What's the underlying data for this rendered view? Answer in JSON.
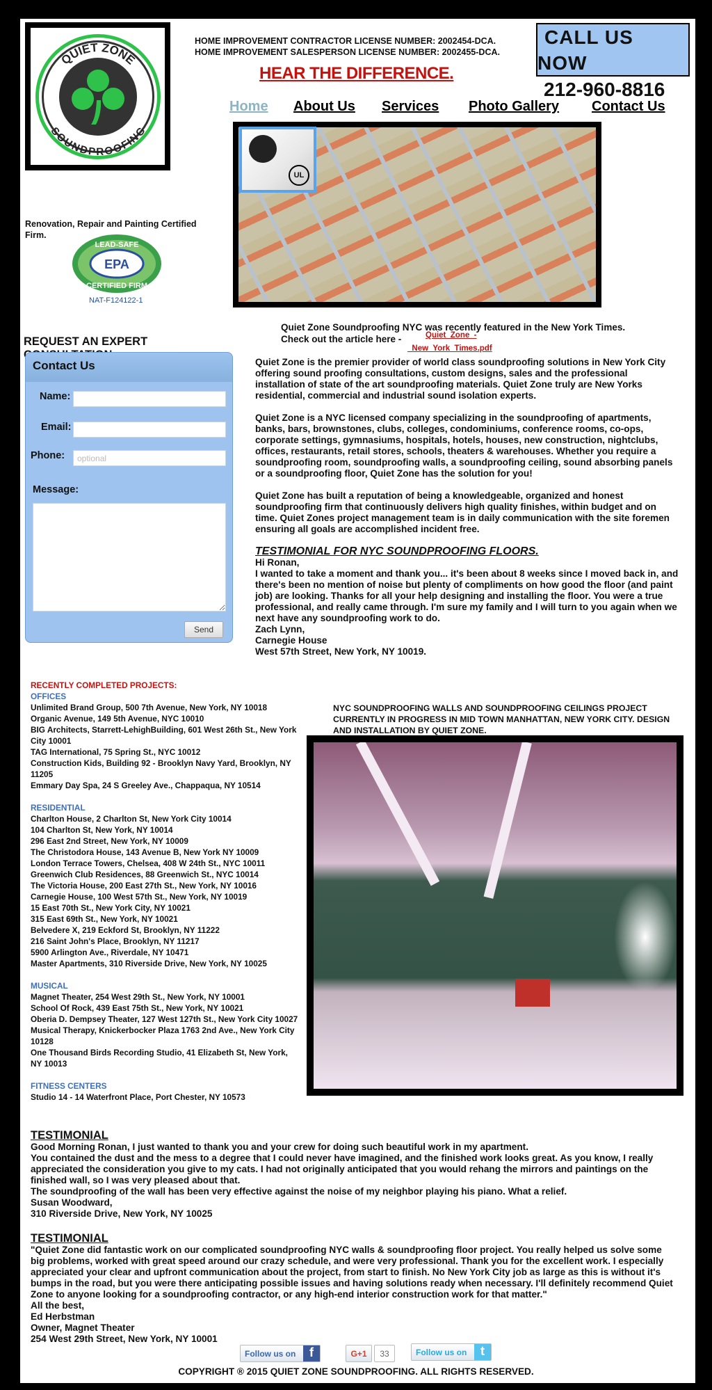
{
  "logo": {
    "top_text": "QUIET ZONE",
    "bottom_text": "SOUNDPROOFING"
  },
  "header": {
    "license_1": "HOME IMPROVEMENT CONTRACTOR LICENSE NUMBER: 2002454-DCA.",
    "license_2": "HOME IMPROVEMENT SALESPERSON LICENSE NUMBER: 2002455-DCA.",
    "tagline": "HEAR THE DIFFERENCE.",
    "call_line1": "CALL US",
    "call_line2": "NOW",
    "phone": "212-960-8816"
  },
  "nav": {
    "items": [
      {
        "label": "Home",
        "active": true
      },
      {
        "label": "About Us"
      },
      {
        "label": "Services"
      },
      {
        "label": "Photo Gallery"
      },
      {
        "label": "Contact Us"
      }
    ]
  },
  "certification": {
    "text": "Renovation, Repair and Painting Certified Firm.",
    "badge_top": "LEAD-SAFE",
    "badge_mid": "EPA",
    "badge_bottom": "CERTIFIED FIRM",
    "number": "NAT-F124122-1",
    "ul_mark": "UL"
  },
  "nyt": {
    "text": "Quiet Zone Soundproofing NYC was recently featured in the New York Times. Check out the article here -",
    "link_part1": "Quiet_Zone_-",
    "link_part2": "_New_York_Times.pdf"
  },
  "form": {
    "request_title": "REQUEST AN EXPERT CONSULTATION",
    "title": "Contact Us",
    "name_label": "Name:",
    "name_value": "",
    "email_label": "Email:",
    "email_value": "",
    "phone_label": "Phone:",
    "phone_placeholder": "optional",
    "message_label": "Message:",
    "message_value": "",
    "send_label": "Send"
  },
  "main": {
    "p1": "Quiet Zone is the premier provider of world class soundproofing solutions in New York City offering sound proofing consultations, custom designs, sales and the professional installation of state of the art soundproofing materials. Quiet Zone truly are New Yorks residential, commercial and industrial sound isolation experts.",
    "p2": "Quiet Zone is a NYC licensed company specializing in the soundproofing of apartments, banks, bars, brownstones, clubs, colleges, condominiums, conference rooms, co-ops, corporate settings, gymnasiums, hospitals, hotels, houses, new construction, nightclubs, offices, restaurants, retail stores, schools, theaters & warehouses. Whether you require a soundproofing room, soundproofing walls, a soundproofing ceiling, sound absorbing panels or a soundproofing floor, Quiet Zone has the solution for you!",
    "p3": "Quiet Zone has built a reputation of being a knowledgeable, organized and honest soundproofing firm that continuously delivers high quality finishes, within budget and on time. Quiet Zones project management team is in daily communication with the site foremen ensuring all goals are accomplished incident free.",
    "testimonial_heading": "TESTIMONIAL FOR NYC SOUNDPROOFING FLOORS.",
    "testimonial_lines": [
      "Hi Ronan,",
      "I wanted to take a moment and thank you... it's been about 8 weeks since I moved back in, and there's been no mention of noise but plenty of compliments on how good the floor (and paint job) are looking. Thanks for all your help designing and installing the floor. You were a true professional, and really came through. I'm sure my family and I will turn to you again when we next have any soundproofing work to do.",
      "Zach Lynn,",
      "Carnegie House",
      "West 57th Street, New York, NY 10019."
    ]
  },
  "projects": {
    "title": "RECENTLY COMPLETED PROJECTS:",
    "categories": [
      {
        "name": "OFFICES",
        "items": [
          "Unlimited Brand Group, 500 7th Avenue, New York, NY 10018",
          "Organic Avenue, 149 5th Avenue, NYC 10010",
          "BIG Architects, Starrett-LehighBuilding, 601 West 26th St., New York City 10001",
          "TAG International, 75 Spring St., NYC 10012",
          "Construction Kids, Building 92 - Brooklyn Navy Yard, Brooklyn, NY 11205",
          "Emmary Day Spa, 24 S Greeley Ave., Chappaqua, NY 10514"
        ]
      },
      {
        "name": "RESIDENTIAL",
        "items": [
          "Charlton House, 2 Charlton St, New York City 10014",
          "104 Charlton St, New York, NY 10014",
          "296 East 2nd Street, New York, NY 10009",
          "The Christodora House, 143 Avenue B, New York NY 10009",
          "London Terrace Towers, Chelsea, 408 W 24th St., NYC 10011",
          "Greenwich Club Residences, 88 Greenwich St., NYC 10014",
          "The Victoria House, 200 East 27th St., New York, NY 10016",
          "Carnegie House, 100 West 57th St., New York, NY 10019",
          "15 East 70th St., New York City, NY 10021",
          "315 East 69th St., New York, NY 10021",
          "Belvedere X, 219 Eckford St, Brooklyn, NY 11222",
          "216 Saint John's Place, Brooklyn, NY 11217",
          "5900 Arlington Ave., Riverdale, NY 10471",
          "Master Apartments, 310 Riverside Drive, New York, NY 10025"
        ]
      },
      {
        "name": "MUSICAL",
        "items": [
          "Magnet Theater, 254 West 29th St., New York, NY 10001",
          "School Of Rock, 439 East 75th St., New York, NY 10021",
          "Oberia D. Dempsey Theater, 127 West 127th St., New York City 10027",
          "Musical Therapy, Knickerbocker Plaza 1763 2nd Ave., New York City 10128",
          "One Thousand Birds Recording Studio, 41 Elizabeth St, New York, NY 10013"
        ]
      },
      {
        "name": "FITNESS CENTERS",
        "items": [
          "Studio 14 - 14 Waterfront Place, Port Chester, NY 10573"
        ]
      }
    ]
  },
  "project_caption": "NYC SOUNDPROOFING WALLS AND SOUNDPROOFING CEILINGS PROJECT CURRENTLY IN PROGRESS IN MID TOWN MANHATTAN, NEW YORK CITY. DESIGN AND INSTALLATION BY QUIET ZONE.",
  "testimonial1": {
    "heading": "TESTIMONIAL",
    "lines": [
      "Good Morning Ronan, I just wanted to thank you and your crew for doing such beautiful work in my apartment.",
      "You contained the dust and the mess to a degree that I could never have imagined, and the finished work looks great. As you know, I really appreciated the consideration you give to my cats. I had not originally anticipated that you would rehang the mirrors and paintings on the finished wall, so I was very pleased about that.",
      "The soundproofing of the wall has been very effective against the noise of my neighbor playing his piano. What a relief.",
      "Susan Woodward,",
      "310 Riverside Drive, New York, NY 10025"
    ]
  },
  "testimonial2": {
    "heading": "TESTIMONIAL",
    "lines": [
      "\"Quiet Zone did fantastic work on our complicated soundproofing NYC walls & soundproofing floor project. You really helped us solve some big problems, worked with great speed around our crazy schedule, and were very professional. Thank you for the excellent work. I especially appreciated your clear and upfront communication about the project, from start to finish. No New York City job as large as this is without it's bumps in the road, but you were there anticipating possible issues and having solutions ready when necessary. I'll definitely recommend Quiet Zone to anyone looking for a soundproofing contractor, or any high-end interior construction work for that matter.\"",
      "All the best,",
      "Ed Herbstman",
      "Owner, Magnet Theater",
      "254 West 29th Street, New York, NY 10001"
    ]
  },
  "social": {
    "facebook_label": "Follow us on",
    "facebook_glyph": "f",
    "gplus_label": "G+1",
    "gplus_count": "33",
    "twitter_label": "Follow us on",
    "twitter_glyph": "t"
  },
  "footer": {
    "copyright": "COPYRIGHT ® 2015 QUIET ZONE SOUNDPROOFING. ALL RIGHTS RESERVED."
  },
  "colors": {
    "accent_red": "#c4120f",
    "category_blue": "#3d6fbf",
    "call_box": "#9fc5f0",
    "form_bg": "#9dc3ee",
    "nav_active": "#8eb3c2",
    "logo_green": "#2fc24a"
  }
}
